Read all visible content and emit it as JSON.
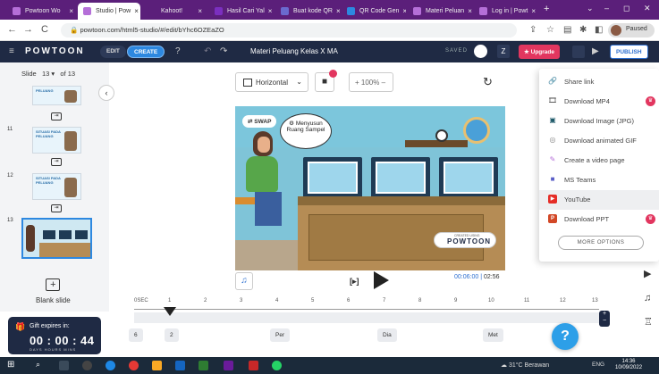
{
  "browser": {
    "tabs": [
      {
        "label": "Powtoon Wo",
        "color": "#b56fd8"
      },
      {
        "label": "Studio | Pow",
        "color": "#b56fd8"
      },
      {
        "label": "Kahoot!",
        "color": "#5b1f7a"
      },
      {
        "label": "Hasil Cari Yal",
        "color": "#7b2fbf"
      },
      {
        "label": "Buat kode QR",
        "color": "#6a6acf"
      },
      {
        "label": "QR Code Gen",
        "color": "#2d88e0"
      },
      {
        "label": "Materi Peluan",
        "color": "#b56fd8"
      },
      {
        "label": "Log in | Powt",
        "color": "#b56fd8"
      }
    ],
    "new_tab": "+",
    "url": "powtoon.com/html5-studio/#/edit/bYhc6OZEaZO",
    "profile_status": "Paused",
    "close_glyph": "×",
    "back_glyph": "←",
    "forward_glyph": "→",
    "reload_glyph": "C",
    "minimize_glyph": "–",
    "maximize_glyph": "◻",
    "window_close_glyph": "✕",
    "chevron_glyph": "⌄"
  },
  "app": {
    "logo": "POWTOON",
    "edit_label": "EDIT",
    "create_label": "CREATE",
    "doc_title": "Materi Peluang Kelas X MA",
    "saved_label": "SAVED",
    "user_initial": "Z",
    "upgrade_label": "Upgrade",
    "publish_label": "PUBLISH",
    "menu_glyph": "≡",
    "help_glyph": "?",
    "undo_glyph": "↶",
    "redo_glyph": "↷"
  },
  "slides_panel": {
    "slide_label": "Slide",
    "current": "13",
    "of_label": "of 13",
    "thumbs": [
      {
        "num": "",
        "caption": "PELUANG"
      },
      {
        "num": "11",
        "caption": "SITUASI PADA PELUANG"
      },
      {
        "num": "12",
        "caption": "SITUASI PADA PELUANG"
      },
      {
        "num": "13",
        "caption": ""
      }
    ],
    "blank_slide_label": "Blank slide",
    "plus_glyph": "+"
  },
  "gift": {
    "label": "Gift expires in:",
    "time": "00 : 00 : 44",
    "units": "DAYS  HOURS  MINS"
  },
  "canvas_toolbar": {
    "orientation": "Horizontal",
    "zoom": "100%"
  },
  "slide_canvas": {
    "swap_label": "SWAP",
    "bubble_text": "Menyusun Ruang Sampel",
    "watermark_small": "CREATED USING",
    "watermark": "POWTOON"
  },
  "player": {
    "current_time": "00:06:00",
    "total_time": "02:56"
  },
  "timeline": {
    "ticks": [
      "0SEC",
      "1",
      "2",
      "3",
      "4",
      "5",
      "6",
      "7",
      "8",
      "9",
      "10",
      "11",
      "12",
      "13"
    ],
    "chips": [
      "6",
      "2",
      "Per",
      "Dia",
      "Met"
    ],
    "playhead_sec": 1
  },
  "publish_menu": {
    "items": [
      {
        "label": "Share link",
        "icon": "🔗",
        "badge": false
      },
      {
        "label": "Download MP4",
        "icon": "🎞",
        "badge": true
      },
      {
        "label": "Download Image (JPG)",
        "icon": "▣",
        "badge": false
      },
      {
        "label": "Download animated GIF",
        "icon": "◎",
        "badge": false
      },
      {
        "label": "Create a video page",
        "icon": "✎",
        "badge": false
      },
      {
        "label": "MS Teams",
        "icon": "■",
        "badge": false
      },
      {
        "label": "YouTube",
        "icon": "▶",
        "badge": false
      },
      {
        "label": "Download PPT",
        "icon": "P",
        "badge": true
      }
    ],
    "badge_icon": "♛",
    "more_options": "MORE OPTIONS"
  },
  "taskbar": {
    "weather": "31°C  Berawan",
    "lang": "ENG",
    "time": "14:36",
    "date": "10/09/2022"
  },
  "colors": {
    "accent": "#2d88e0",
    "upgrade": "#e2365f",
    "header": "#1f2a44",
    "tabbar": "#5b1f7a"
  }
}
